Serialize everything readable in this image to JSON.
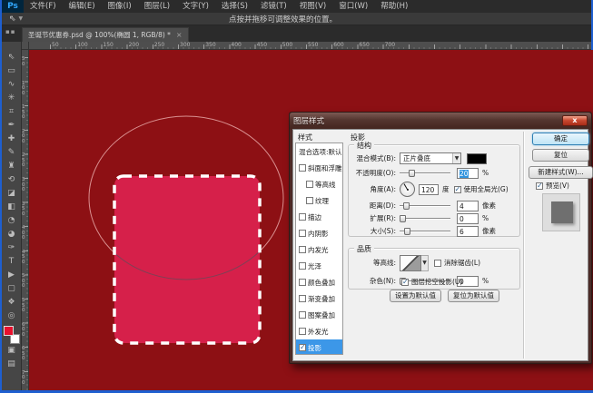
{
  "menu_bar": {
    "logo": "Ps",
    "items": [
      "文件(F)",
      "编辑(E)",
      "图像(I)",
      "图层(L)",
      "文字(Y)",
      "选择(S)",
      "滤镜(T)",
      "视图(V)",
      "窗口(W)",
      "帮助(H)"
    ]
  },
  "options_bar": {
    "hint": "点按并拖移可调整效果的位置。"
  },
  "tab": {
    "label": "圣诞节优惠券.psd @ 100%(椭圆 1, RGB/8) *",
    "close": "×"
  },
  "rulers": {
    "h_labels": [
      "50",
      "100",
      "150",
      "200",
      "250",
      "300",
      "350",
      "400",
      "450",
      "500",
      "550",
      "600",
      "650",
      "700"
    ],
    "v_labels": [
      "50",
      "100",
      "150",
      "200",
      "250",
      "300",
      "350",
      "400",
      "450",
      "500",
      "550",
      "600",
      "650",
      "700"
    ]
  },
  "toolbar": {
    "tools": [
      {
        "name": "move-tool",
        "glyph": "⇖"
      },
      {
        "name": "marquee-tool",
        "glyph": "▭"
      },
      {
        "name": "lasso-tool",
        "glyph": "∿"
      },
      {
        "name": "quick-selection-tool",
        "glyph": "✳"
      },
      {
        "name": "crop-tool",
        "glyph": "⌗"
      },
      {
        "name": "eyedropper-tool",
        "glyph": "✒"
      },
      {
        "name": "healing-brush-tool",
        "glyph": "✚"
      },
      {
        "name": "brush-tool",
        "glyph": "✎"
      },
      {
        "name": "clone-stamp-tool",
        "glyph": "♜"
      },
      {
        "name": "history-brush-tool",
        "glyph": "⟲"
      },
      {
        "name": "eraser-tool",
        "glyph": "◪"
      },
      {
        "name": "gradient-tool",
        "glyph": "◧"
      },
      {
        "name": "blur-tool",
        "glyph": "◔"
      },
      {
        "name": "dodge-tool",
        "glyph": "◕"
      },
      {
        "name": "pen-tool",
        "glyph": "✑"
      },
      {
        "name": "type-tool",
        "glyph": "T"
      },
      {
        "name": "path-selection-tool",
        "glyph": "▶"
      },
      {
        "name": "shape-tool",
        "glyph": "▢"
      },
      {
        "name": "hand-tool",
        "glyph": "❖"
      },
      {
        "name": "zoom-tool",
        "glyph": "◎"
      }
    ],
    "foreground_color": "#e8112d",
    "background_color": "#ffffff",
    "quick_mask_glyph": "▣",
    "screen_mode_glyph": "▤"
  },
  "canvas": {
    "background": "#8d1014",
    "shape_fill": "#d6204a",
    "ants_color": "#ffffff",
    "ellipse_stroke_outer": "#d99090",
    "ellipse_stroke_inner": "#7e4055"
  },
  "dialog": {
    "title": "图层样式",
    "close": "x",
    "styles_panel": {
      "header": "样式",
      "items": [
        {
          "label": "混合选项:默认",
          "type": "plain"
        },
        {
          "label": "斜面和浮雕",
          "checked": false
        },
        {
          "label": "等高线",
          "checked": false,
          "indent": true
        },
        {
          "label": "纹理",
          "checked": false,
          "indent": true
        },
        {
          "label": "描边",
          "checked": false
        },
        {
          "label": "内阴影",
          "checked": false
        },
        {
          "label": "内发光",
          "checked": false
        },
        {
          "label": "光泽",
          "checked": false
        },
        {
          "label": "颜色叠加",
          "checked": false
        },
        {
          "label": "渐变叠加",
          "checked": false
        },
        {
          "label": "图案叠加",
          "checked": false
        },
        {
          "label": "外发光",
          "checked": false
        },
        {
          "label": "投影",
          "checked": true,
          "selected": true
        }
      ]
    },
    "shadow_panel": {
      "header": "投影",
      "structure": {
        "label": "结构",
        "blend_mode": {
          "label": "混合模式(B):",
          "value": "正片叠底",
          "swatch": "#000000"
        },
        "opacity": {
          "label": "不透明度(O):",
          "value": "20",
          "unit": "%",
          "thumb_pct": 20,
          "selected": true
        },
        "angle": {
          "label": "角度(A):",
          "value": "120",
          "unit": "度",
          "use_global_label": "使用全局光(G)",
          "use_global_checked": true
        },
        "distance": {
          "label": "距离(D):",
          "value": "4",
          "unit": "像素",
          "thumb_pct": 8
        },
        "spread": {
          "label": "扩展(R):",
          "value": "0",
          "unit": "%",
          "thumb_pct": 1
        },
        "size": {
          "label": "大小(S):",
          "value": "6",
          "unit": "像素",
          "thumb_pct": 10
        }
      },
      "quality": {
        "label": "品质",
        "contour_label": "等高线:",
        "anti_alias_label": "消除锯齿(L)",
        "anti_alias_checked": false,
        "noise": {
          "label": "杂色(N):",
          "value": "0",
          "unit": "%",
          "thumb_pct": 1
        }
      },
      "knockout_label": "图层挖空投影(U)",
      "knockout_checked": true,
      "set_default_label": "设置为默认值",
      "reset_default_label": "复位为默认值"
    },
    "actions": {
      "ok": "确定",
      "reset": "复位",
      "new_style": "新建样式(W)...",
      "preview_label": "预览(V)",
      "preview_checked": true
    }
  }
}
